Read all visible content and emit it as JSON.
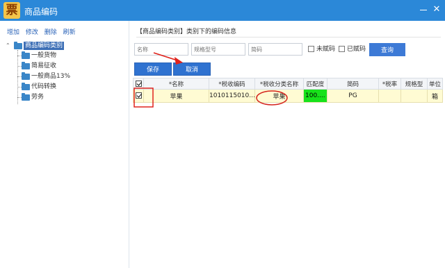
{
  "window": {
    "icon_glyph": "票",
    "title": "商品编码"
  },
  "sidebar": {
    "actions": [
      "增加",
      "修改",
      "删除",
      "刷新"
    ],
    "tree_root": "商品编码类别",
    "tree_items": [
      "一般货物",
      "简易征收",
      "一般商品13%",
      "代码转换",
      "劳务"
    ]
  },
  "main": {
    "breadcrumb": "【商品编码类别】类别下的编码信息",
    "filters": {
      "name_placeholder": "名称",
      "spec_placeholder": "规格型号",
      "short_code_placeholder": "简码",
      "uncoded_label": "未赋码",
      "coded_label": "已赋码",
      "query_label": "查询"
    },
    "save_label": "保存",
    "cancel_label": "取消",
    "grid": {
      "columns": [
        "*名称",
        "*税收编码",
        "*税收分类名称",
        "匹配度",
        "简码",
        "*税率",
        "规格型",
        "单位"
      ],
      "rows": [
        {
          "checked": true,
          "name": "苹果",
          "tax_code": "1010115010...",
          "tax_category": "苹果",
          "match": "100....",
          "short_code": "PG",
          "tax_rate": "",
          "spec": "",
          "unit": "箱"
        }
      ]
    }
  },
  "colors": {
    "titlebar": "#2b88d8",
    "button": "#2f72d0",
    "row_highlight": "#fffbd3",
    "match_green": "#17e21a",
    "annotation_red": "#e0231c"
  }
}
